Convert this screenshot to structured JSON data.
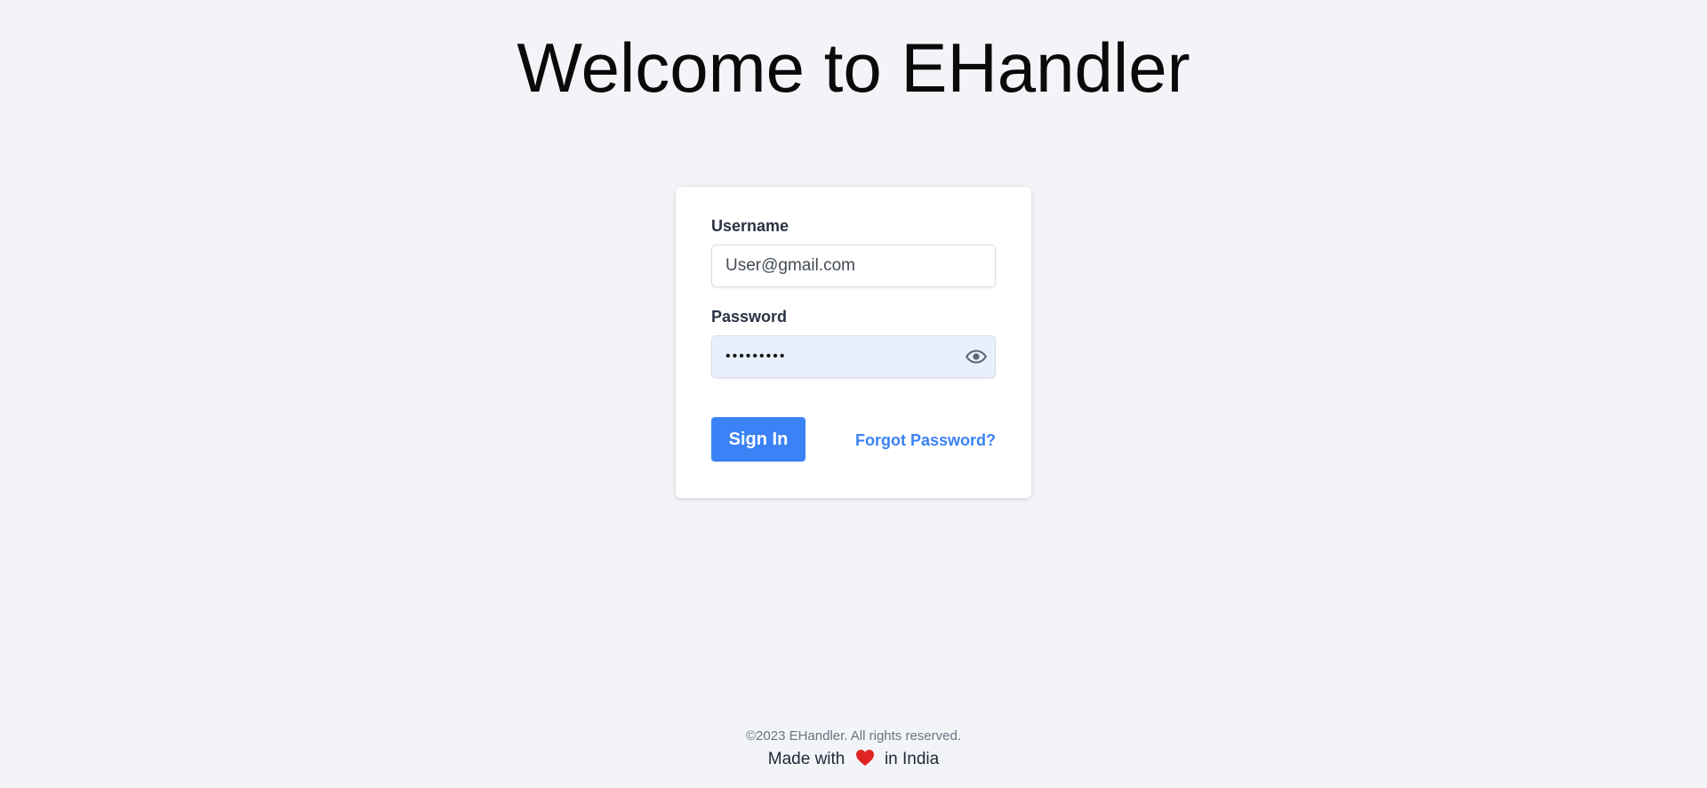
{
  "header": {
    "title": "Welcome to EHandler"
  },
  "login_form": {
    "username": {
      "label": "Username",
      "value": "User@gmail.com"
    },
    "password": {
      "label": "Password",
      "value": "•••••••••",
      "toggle_icon": "eye-icon"
    },
    "sign_in_label": "Sign In",
    "forgot_password_label": "Forgot Password?"
  },
  "footer": {
    "copyright": "©2023 EHandler. All rights reserved.",
    "made_with_prefix": "Made with",
    "made_with_icon": "heart-icon",
    "made_with_suffix": "in India"
  },
  "colors": {
    "accent": "#3b82f6",
    "background": "#f2f4f8",
    "heart": "#e02424"
  }
}
